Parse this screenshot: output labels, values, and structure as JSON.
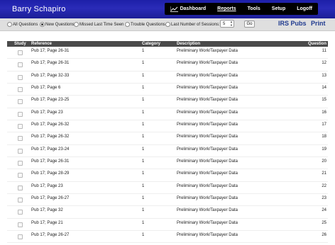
{
  "header": {
    "brand": "Barry Schapiro",
    "nav": [
      {
        "label": "Dashboard",
        "icon": "line-chart-icon"
      },
      {
        "label": "Reports"
      },
      {
        "label": "Tools"
      },
      {
        "label": "Setup"
      },
      {
        "label": "Logoff"
      }
    ]
  },
  "filters": {
    "options": [
      {
        "label": "All Questions",
        "checked": false
      },
      {
        "label": "New Questions",
        "checked": true
      },
      {
        "label": "Missed Last Time Seen",
        "checked": false
      },
      {
        "label": "Trouble Questions",
        "checked": false
      },
      {
        "label": "Last Number of Sessions:",
        "checked": false
      }
    ],
    "sessions_value": "5",
    "go_label": "Go",
    "irs_pubs_label": "IRS Pubs",
    "print_label": "Print"
  },
  "table": {
    "columns": [
      "Study",
      "Reference",
      "Category",
      "Description",
      "Question"
    ],
    "rows": [
      {
        "reference": "Pub 17; Page 26-31",
        "category": "1",
        "description": "Preliminary Work/Taxpayer Data",
        "question": "11"
      },
      {
        "reference": "Pub 17; Page 26-31",
        "category": "1",
        "description": "Preliminary Work/Taxpayer Data",
        "question": "12"
      },
      {
        "reference": "Pub 17; Page 32-33",
        "category": "1",
        "description": "Preliminary Work/Taxpayer Data",
        "question": "13"
      },
      {
        "reference": "Pub 17; Page 6",
        "category": "1",
        "description": "Preliminary Work/Taxpayer Data",
        "question": "14"
      },
      {
        "reference": "Pub 17; Page 23-25",
        "category": "1",
        "description": "Preliminary Work/Taxpayer Data",
        "question": "15"
      },
      {
        "reference": "Pub 17; Page 23",
        "category": "1",
        "description": "Preliminary Work/Taxpayer Data",
        "question": "16"
      },
      {
        "reference": "Pub 17; Page 26-32",
        "category": "1",
        "description": "Preliminary Work/Taxpayer Data",
        "question": "17"
      },
      {
        "reference": "Pub 17; Page 26-32",
        "category": "1",
        "description": "Preliminary Work/Taxpayer Data",
        "question": "18"
      },
      {
        "reference": "Pub 17; Page 23-24",
        "category": "1",
        "description": "Preliminary Work/Taxpayer Data",
        "question": "19"
      },
      {
        "reference": "Pub 17; Page 26-31",
        "category": "1",
        "description": "Preliminary Work/Taxpayer Data",
        "question": "20"
      },
      {
        "reference": "Pub 17; Page 28-29",
        "category": "1",
        "description": "Preliminary Work/Taxpayer Data",
        "question": "21"
      },
      {
        "reference": "Pub 17; Page 23",
        "category": "1",
        "description": "Preliminary Work/Taxpayer Data",
        "question": "22"
      },
      {
        "reference": "Pub 17; Page 26-27",
        "category": "1",
        "description": "Preliminary Work/Taxpayer Data",
        "question": "23"
      },
      {
        "reference": "Pub 17; Page 32",
        "category": "1",
        "description": "Preliminary Work/Taxpayer Data",
        "question": "24"
      },
      {
        "reference": "Pub 17; Page 21",
        "category": "1",
        "description": "Preliminary Work/Taxpayer Data",
        "question": "25"
      },
      {
        "reference": "Pub 17; Page 26-27",
        "category": "1",
        "description": "Preliminary Work/Taxpayer Data",
        "question": "26"
      }
    ]
  }
}
